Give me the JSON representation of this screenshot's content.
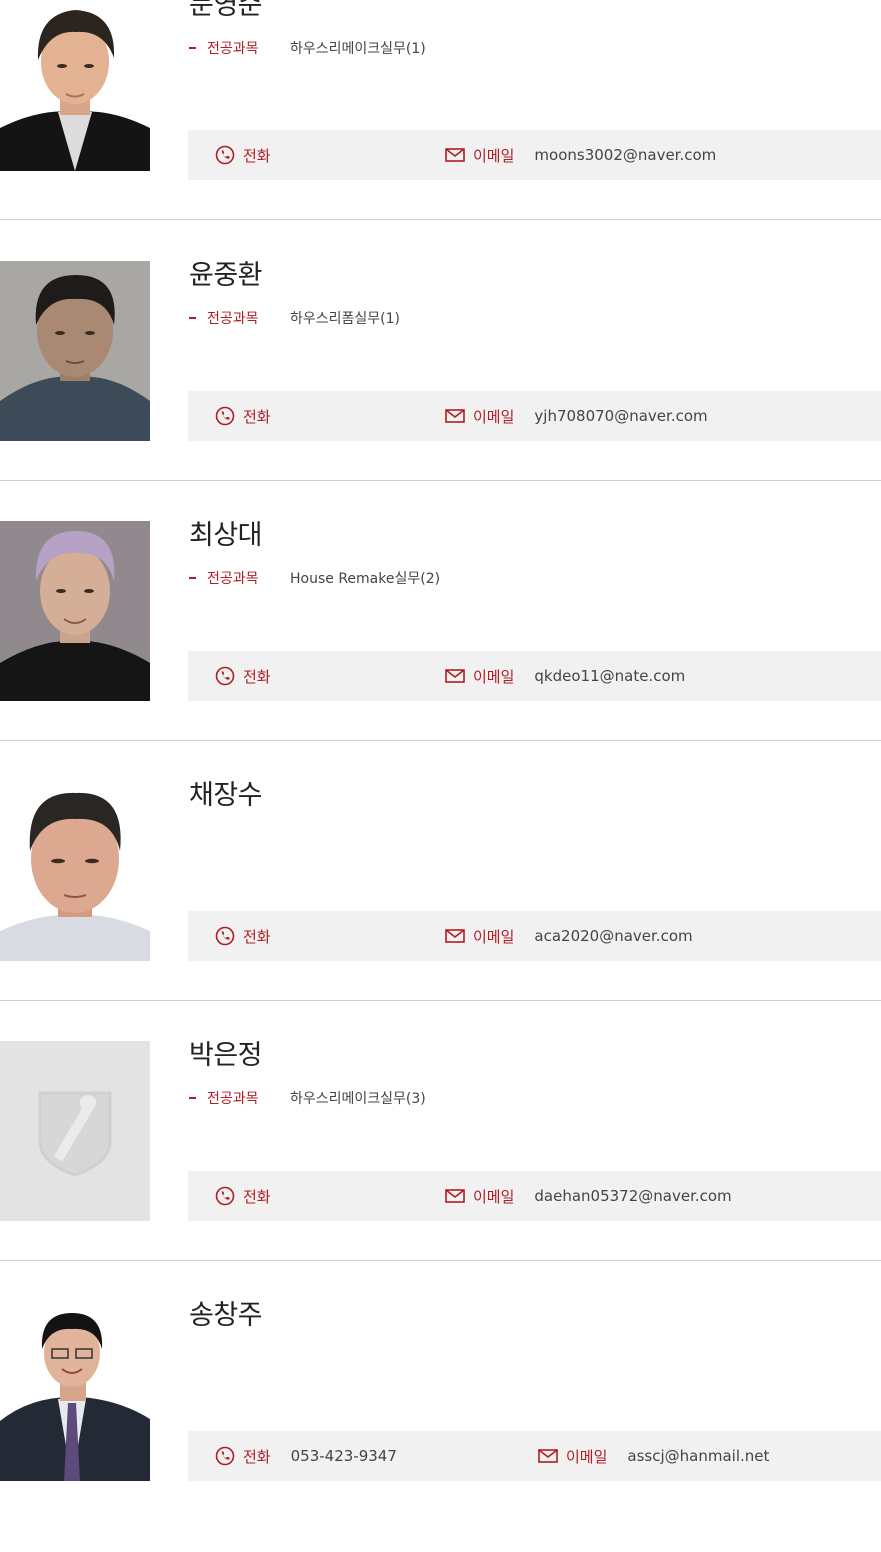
{
  "labels": {
    "subject": "전공과목",
    "phone": "전화",
    "email": "이메일"
  },
  "accent_color": "#b01e23",
  "people": [
    {
      "name": "문영준",
      "subject": "하우스리메이크실무(1)",
      "phone": "",
      "email": "moons3002@naver.com"
    },
    {
      "name": "윤중환",
      "subject": "하우스리폼실무(1)",
      "phone": "",
      "email": "yjh708070@naver.com"
    },
    {
      "name": "최상대",
      "subject": "House Remake실무(2)",
      "phone": "",
      "email": "qkdeo11@nate.com"
    },
    {
      "name": "채장수",
      "subject": "",
      "phone": "",
      "email": "aca2020@naver.com"
    },
    {
      "name": "박은정",
      "subject": "하우스리메이크실무(3)",
      "phone": "",
      "email": "daehan05372@naver.com"
    },
    {
      "name": "송창주",
      "subject": "",
      "phone": "053-423-9347",
      "email": "asscj@hanmail.net"
    }
  ]
}
